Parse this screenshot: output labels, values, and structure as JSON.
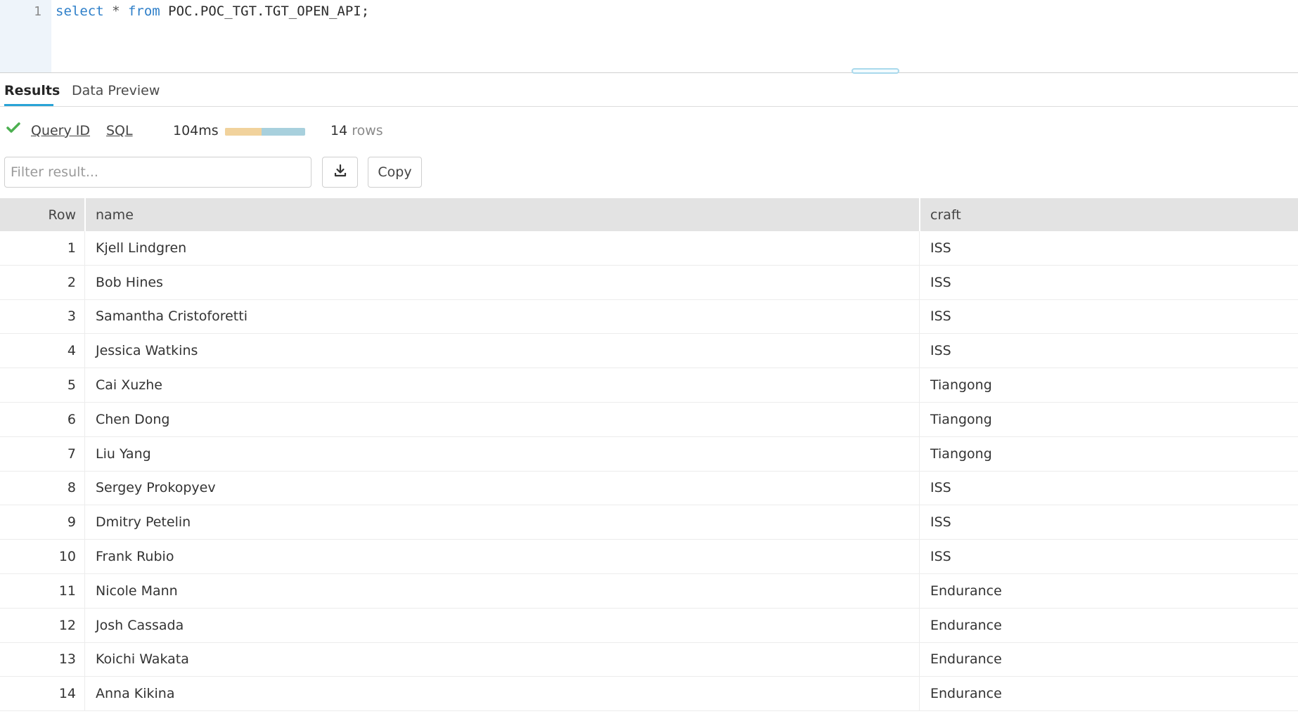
{
  "editor": {
    "line_number": "1",
    "kw_select": "select",
    "star": " * ",
    "kw_from": "from",
    "table": " POC.POC_TGT.TGT_OPEN_API;"
  },
  "tabs": [
    {
      "label": "Results",
      "active": true
    },
    {
      "label": "Data Preview",
      "active": false
    }
  ],
  "status": {
    "query_id_label": "Query ID",
    "sql_label": "SQL",
    "duration": "104ms",
    "rows_count": "14",
    "rows_unit": "rows",
    "success_color": "#4caf50"
  },
  "toolbar": {
    "filter_placeholder": "Filter result...",
    "download_icon": "download-icon",
    "copy_label": "Copy"
  },
  "table": {
    "columns": [
      "Row",
      "name",
      "craft"
    ],
    "rows": [
      [
        "1",
        "Kjell Lindgren",
        "ISS"
      ],
      [
        "2",
        "Bob Hines",
        "ISS"
      ],
      [
        "3",
        "Samantha Cristoforetti",
        "ISS"
      ],
      [
        "4",
        "Jessica Watkins",
        "ISS"
      ],
      [
        "5",
        "Cai Xuzhe",
        "Tiangong"
      ],
      [
        "6",
        "Chen Dong",
        "Tiangong"
      ],
      [
        "7",
        "Liu Yang",
        "Tiangong"
      ],
      [
        "8",
        "Sergey Prokopyev",
        "ISS"
      ],
      [
        "9",
        "Dmitry Petelin",
        "ISS"
      ],
      [
        "10",
        "Frank Rubio",
        "ISS"
      ],
      [
        "11",
        "Nicole Mann",
        "Endurance"
      ],
      [
        "12",
        "Josh Cassada",
        "Endurance"
      ],
      [
        "13",
        "Koichi Wakata",
        "Endurance"
      ],
      [
        "14",
        "Anna Kikina",
        "Endurance"
      ]
    ]
  }
}
